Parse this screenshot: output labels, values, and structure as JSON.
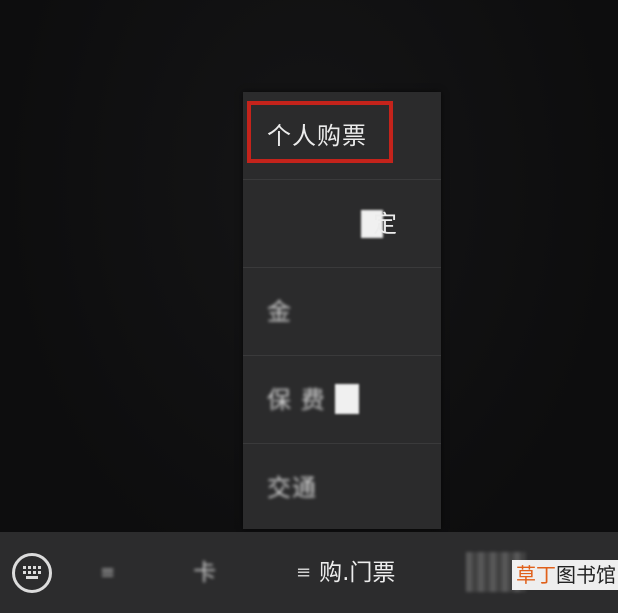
{
  "menu": {
    "items": [
      {
        "label": "个人购票",
        "highlighted": true
      },
      {
        "label": "定",
        "obscured": true
      },
      {
        "label": "金",
        "obscured": true
      },
      {
        "label": "保  费",
        "obscured": true
      },
      {
        "label": "交通",
        "obscured": true
      }
    ]
  },
  "bottom_bar": {
    "keyboard_icon": "keyboard-icon",
    "tabs": [
      {
        "label": "卡",
        "obscured": true
      },
      {
        "label": "购.门票"
      }
    ]
  },
  "watermark": {
    "part1": "草丁",
    "part2": "图书馆"
  },
  "colors": {
    "highlight": "#c4231b",
    "menu_bg": "#2b2b2c",
    "bar_bg": "#2c2c2d"
  }
}
